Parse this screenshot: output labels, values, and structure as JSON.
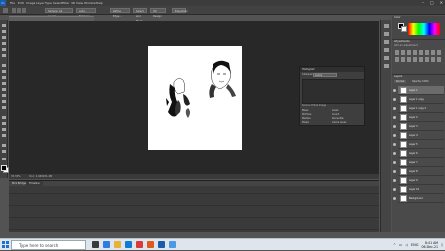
{
  "menubar": {
    "app_badge": "Ps",
    "items": [
      "File",
      "Edit",
      "Image",
      "Layer",
      "Type",
      "Select",
      "Filter",
      "3D",
      "View",
      "Window",
      "Help"
    ]
  },
  "options": {
    "sample": "Sample: All Layers",
    "auto": "Auto-Enhance",
    "refine": "Refine Edge...",
    "select_mask": "Select and Mask...",
    "workspace": "3D Design",
    "mode": "Essentials"
  },
  "document": {
    "tab": "Untitled-1 @ 33.3% (Layer 1, RGB/8) *",
    "zoom": "33.33%",
    "doc_info": "Doc: 2.64M/21.4M"
  },
  "timeline": {
    "tabs": [
      "Mini Bridge",
      "Timeline"
    ]
  },
  "histogram": {
    "title": "Histogram",
    "channel_label": "Channel:",
    "channel": "Colors",
    "source": "Source: Entire Image",
    "stats": [
      "Mean:",
      "Std Dev:",
      "Median:",
      "Pixels:",
      "Level:",
      "Count:",
      "Percentile:",
      "Cache Level:"
    ]
  },
  "panels": {
    "color_title": "Color",
    "adjustments_title": "Adjustments",
    "add_adjustment": "Add an adjustment",
    "layers_title": "Layers",
    "blend_mode": "Normal",
    "opacity": "Opacity: 100%",
    "layers": [
      {
        "name": "Layer 1"
      },
      {
        "name": "Layer 1 copy"
      },
      {
        "name": "Layer 1 copy 2"
      },
      {
        "name": "Layer 2"
      },
      {
        "name": "Layer 3"
      },
      {
        "name": "Layer 4"
      },
      {
        "name": "Layer 5"
      },
      {
        "name": "Layer 6"
      },
      {
        "name": "Layer 7"
      },
      {
        "name": "Layer 8"
      },
      {
        "name": "Layer 9"
      },
      {
        "name": "Layer 10"
      },
      {
        "name": "Background"
      }
    ]
  },
  "taskbar": {
    "search_placeholder": "Type here to search",
    "time": "8:41 AM",
    "date": "06-Dec-21",
    "lang": "ENG"
  },
  "colors": {
    "ps_blue": "#1c5ca8",
    "ui_dark": "#282828",
    "taskbar": "#dfe5ec"
  }
}
